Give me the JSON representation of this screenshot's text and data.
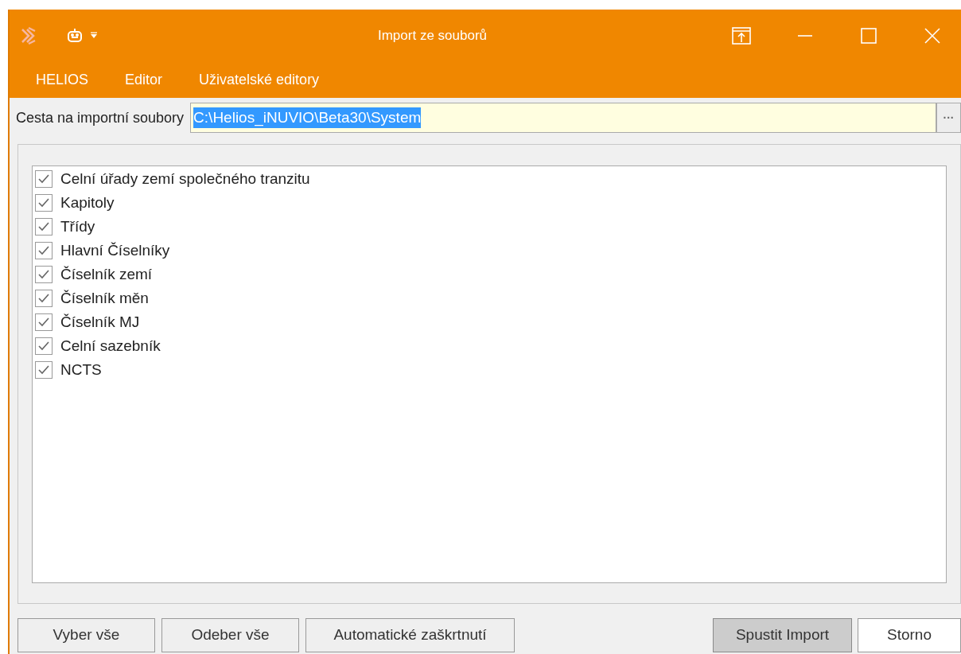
{
  "window": {
    "title": "Import ze souborů"
  },
  "menu": [
    {
      "label": "HELIOS"
    },
    {
      "label": "Editor"
    },
    {
      "label": "Uživatelské editory"
    }
  ],
  "path_field": {
    "label": "Cesta na importní soubory",
    "value": "C:\\Helios_iNUVIO\\Beta30\\System",
    "browse_label": "···"
  },
  "items": [
    {
      "label": "Celní úřady zemí společného tranzitu",
      "checked": true
    },
    {
      "label": "Kapitoly",
      "checked": true
    },
    {
      "label": "Třídy",
      "checked": true
    },
    {
      "label": "Hlavní Číselníky",
      "checked": true
    },
    {
      "label": "Číselník zemí",
      "checked": true
    },
    {
      "label": "Číselník měn",
      "checked": true
    },
    {
      "label": "Číselník MJ",
      "checked": true
    },
    {
      "label": "Celní sazebník",
      "checked": true
    },
    {
      "label": "NCTS",
      "checked": true
    }
  ],
  "buttons_left": [
    {
      "label": "Vyber vše"
    },
    {
      "label": "Odeber vše"
    },
    {
      "label": "Automatické zaškrtnutí"
    }
  ],
  "buttons_right": [
    {
      "label": "Spustit Import",
      "default": true
    },
    {
      "label": "Storno",
      "default": false
    }
  ]
}
